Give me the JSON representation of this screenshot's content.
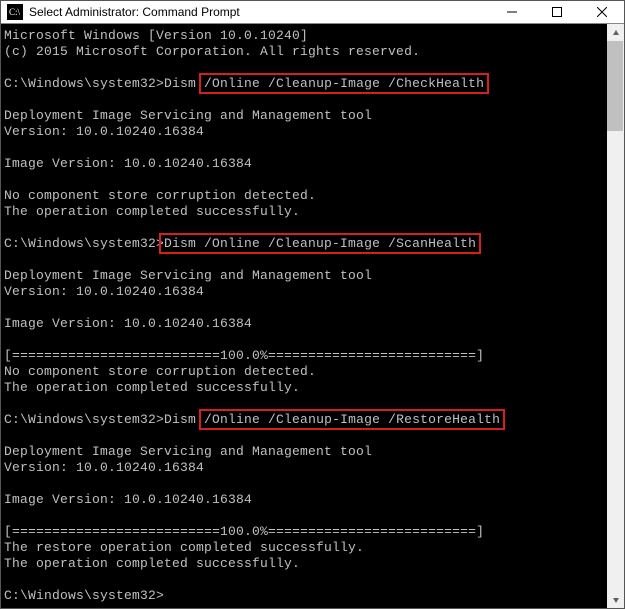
{
  "window": {
    "title": "Select Administrator: Command Prompt"
  },
  "lines": {
    "l0": "Microsoft Windows [Version 10.0.10240]",
    "l1": "(c) 2015 Microsoft Corporation. All rights reserved.",
    "l2": "",
    "p1": "C:\\Windows\\system32>",
    "c1a": "Dism ",
    "c1b": "/Online /Cleanup-Image /CheckHealth",
    "l4": "",
    "l5": "Deployment Image Servicing and Management tool",
    "l6": "Version: 10.0.10240.16384",
    "l7": "",
    "l8": "Image Version: 10.0.10240.16384",
    "l9": "",
    "l10": "No component store corruption detected.",
    "l11": "The operation completed successfully.",
    "l12": "",
    "p2": "C:\\Windows\\system32>",
    "c2": "Dism /Online /Cleanup-Image /ScanHealth",
    "l14": "",
    "l15": "Deployment Image Servicing and Management tool",
    "l16": "Version: 10.0.10240.16384",
    "l17": "",
    "l18": "Image Version: 10.0.10240.16384",
    "l19": "",
    "l20": "[==========================100.0%==========================]",
    "l21": "No component store corruption detected.",
    "l22": "The operation completed successfully.",
    "l23": "",
    "p3": "C:\\Windows\\system32>",
    "c3a": "Dism ",
    "c3b": "/Online /Cleanup-Image /RestoreHealth",
    "l25": "",
    "l26": "Deployment Image Servicing and Management tool",
    "l27": "Version: 10.0.10240.16384",
    "l28": "",
    "l29": "Image Version: 10.0.10240.16384",
    "l30": "",
    "l31": "[==========================100.0%==========================]",
    "l32": "The restore operation completed successfully.",
    "l33": "The operation completed successfully.",
    "l34": "",
    "p4": "C:\\Windows\\system32>"
  },
  "annotations": {
    "highlight_color": "#d62020"
  }
}
